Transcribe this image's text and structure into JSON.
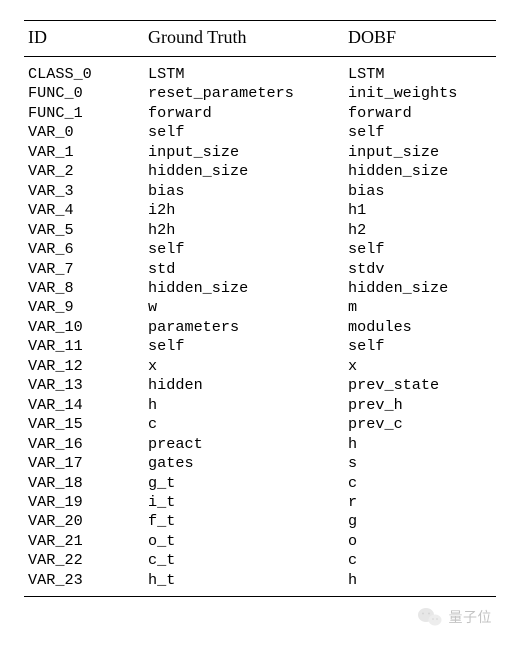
{
  "table": {
    "headers": {
      "id": "ID",
      "gt": "Ground Truth",
      "dobf": "DOBF"
    },
    "rows": [
      {
        "id": "CLASS_0",
        "gt": "LSTM",
        "dobf": "LSTM"
      },
      {
        "id": "FUNC_0",
        "gt": "reset_parameters",
        "dobf": "init_weights"
      },
      {
        "id": "FUNC_1",
        "gt": "forward",
        "dobf": "forward"
      },
      {
        "id": "VAR_0",
        "gt": "self",
        "dobf": "self"
      },
      {
        "id": "VAR_1",
        "gt": "input_size",
        "dobf": "input_size"
      },
      {
        "id": "VAR_2",
        "gt": "hidden_size",
        "dobf": "hidden_size"
      },
      {
        "id": "VAR_3",
        "gt": "bias",
        "dobf": "bias"
      },
      {
        "id": "VAR_4",
        "gt": "i2h",
        "dobf": "h1"
      },
      {
        "id": "VAR_5",
        "gt": "h2h",
        "dobf": "h2"
      },
      {
        "id": "VAR_6",
        "gt": "self",
        "dobf": "self"
      },
      {
        "id": "VAR_7",
        "gt": "std",
        "dobf": "stdv"
      },
      {
        "id": "VAR_8",
        "gt": "hidden_size",
        "dobf": "hidden_size"
      },
      {
        "id": "VAR_9",
        "gt": "w",
        "dobf": "m"
      },
      {
        "id": "VAR_10",
        "gt": "parameters",
        "dobf": "modules"
      },
      {
        "id": "VAR_11",
        "gt": "self",
        "dobf": "self"
      },
      {
        "id": "VAR_12",
        "gt": "x",
        "dobf": "x"
      },
      {
        "id": "VAR_13",
        "gt": "hidden",
        "dobf": "prev_state"
      },
      {
        "id": "VAR_14",
        "gt": "h",
        "dobf": "prev_h"
      },
      {
        "id": "VAR_15",
        "gt": "c",
        "dobf": "prev_c"
      },
      {
        "id": "VAR_16",
        "gt": "preact",
        "dobf": "h"
      },
      {
        "id": "VAR_17",
        "gt": "gates",
        "dobf": "s"
      },
      {
        "id": "VAR_18",
        "gt": "g_t",
        "dobf": "c"
      },
      {
        "id": "VAR_19",
        "gt": "i_t",
        "dobf": "r"
      },
      {
        "id": "VAR_20",
        "gt": "f_t",
        "dobf": "g"
      },
      {
        "id": "VAR_21",
        "gt": "o_t",
        "dobf": "o"
      },
      {
        "id": "VAR_22",
        "gt": "c_t",
        "dobf": "c"
      },
      {
        "id": "VAR_23",
        "gt": "h_t",
        "dobf": "h"
      }
    ]
  },
  "watermark": {
    "text": "量子位"
  }
}
